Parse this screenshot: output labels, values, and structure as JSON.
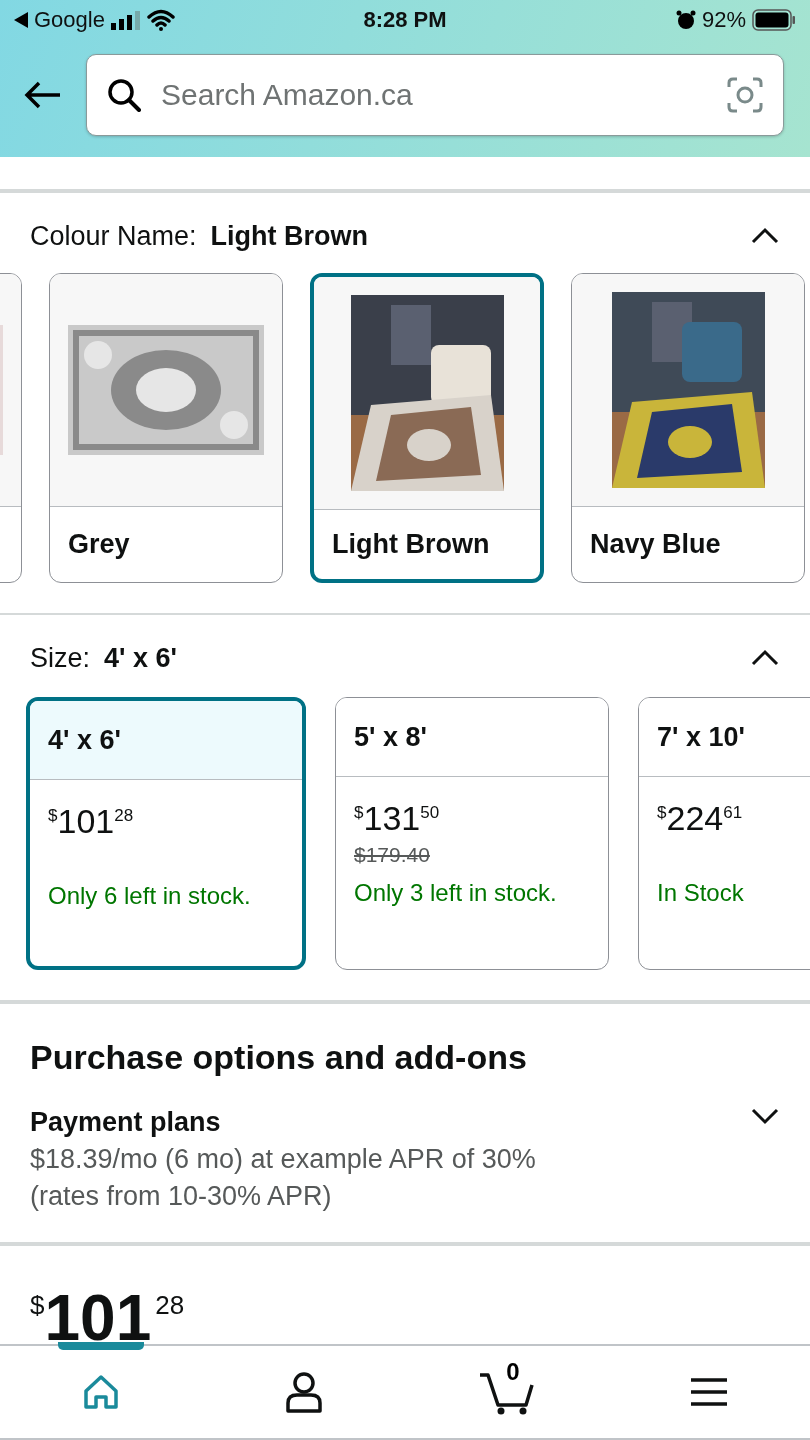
{
  "status_bar": {
    "back_app": "Google",
    "time": "8:28 PM",
    "battery": "92%"
  },
  "search": {
    "placeholder": "Search Amazon.ca"
  },
  "colour": {
    "label": "Colour Name:",
    "value": "Light Brown",
    "expanded": true,
    "swatches": [
      {
        "selected": false
      },
      {
        "label": "Grey",
        "selected": false
      },
      {
        "label": "Light Brown",
        "selected": true
      },
      {
        "label": "Navy Blue",
        "selected": false
      }
    ]
  },
  "size": {
    "label": "Size:",
    "value": "4' x 6'",
    "expanded": true,
    "options": [
      {
        "label": "4' x 6'",
        "symbol": "$",
        "whole": "101",
        "fraction": "28",
        "stock": "Only 6 left in stock.",
        "selected": true
      },
      {
        "label": "5' x 8'",
        "symbol": "$",
        "whole": "131",
        "fraction": "50",
        "list_price": "$179.40",
        "stock": "Only 3 left in stock.",
        "selected": false
      },
      {
        "label": "7' x 10'",
        "symbol": "$",
        "whole": "224",
        "fraction": "61",
        "stock": "In Stock",
        "selected": false
      }
    ]
  },
  "purchase_options": {
    "title": "Purchase options and add-ons",
    "payment_title": "Payment plans",
    "payment_line_1": "$18.39/mo (6 mo) at example APR of 30%",
    "payment_line_2": "(rates from 10-30% APR)",
    "expanded": false
  },
  "price": {
    "symbol": "$",
    "whole": "101",
    "fraction": "28"
  },
  "bottom_nav": [
    {
      "kind": "home",
      "selected": true
    },
    {
      "kind": "account",
      "selected": false
    },
    {
      "kind": "cart",
      "count": "0",
      "selected": false
    },
    {
      "kind": "menu",
      "selected": false
    }
  ]
}
